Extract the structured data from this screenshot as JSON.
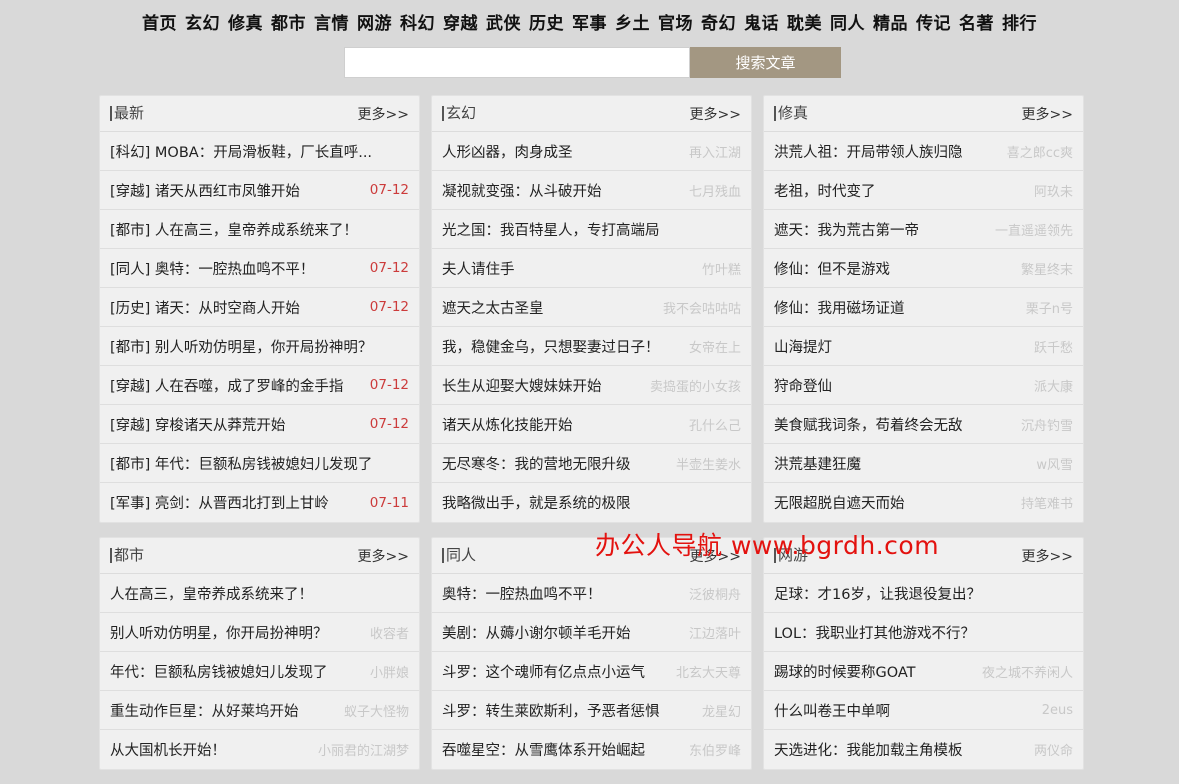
{
  "nav": [
    "首页",
    "玄幻",
    "修真",
    "都市",
    "言情",
    "网游",
    "科幻",
    "穿越",
    "武侠",
    "历史",
    "军事",
    "乡土",
    "官场",
    "奇幻",
    "鬼话",
    "耽美",
    "同人",
    "精品",
    "传记",
    "名著",
    "排行"
  ],
  "search": {
    "placeholder": "",
    "button_label": "搜索文章"
  },
  "panels": [
    {
      "title": "最新",
      "more": "更多>>",
      "rows": [
        {
          "title": "[科幻] MOBA：开局滑板鞋，厂长直呼...",
          "meta": ""
        },
        {
          "title": "[穿越] 诸天从西红市凤雏开始",
          "meta": "07-12"
        },
        {
          "title": "[都市] 人在高三，皇帝养成系统来了！",
          "meta": ""
        },
        {
          "title": "[同人] 奥特：一腔热血鸣不平！",
          "meta": "07-12"
        },
        {
          "title": "[历史] 诸天：从时空商人开始",
          "meta": "07-12"
        },
        {
          "title": "[都市] 别人听劝仿明星，你开局扮神明？",
          "meta": ""
        },
        {
          "title": "[穿越] 人在吞噬，成了罗峰的金手指",
          "meta": "07-12"
        },
        {
          "title": "[穿越] 穿梭诸天从莽荒开始",
          "meta": "07-12"
        },
        {
          "title": "[都市] 年代：巨额私房钱被媳妇儿发现了",
          "meta": ""
        },
        {
          "title": "[军事] 亮剑：从晋西北打到上甘岭",
          "meta": "07-11"
        }
      ]
    },
    {
      "title": "玄幻",
      "more": "更多>>",
      "rows": [
        {
          "title": "人形凶器，肉身成圣",
          "meta": "再入江湖"
        },
        {
          "title": "凝视就变强：从斗破开始",
          "meta": "七月残血"
        },
        {
          "title": "光之国：我百特星人，专打高端局",
          "meta": ""
        },
        {
          "title": "夫人请住手",
          "meta": "竹叶糕"
        },
        {
          "title": "遮天之太古圣皇",
          "meta": "我不会咕咕咕"
        },
        {
          "title": "我，稳健金乌，只想娶妻过日子！",
          "meta": "女帝在上"
        },
        {
          "title": "长生从迎娶大嫂妹妹开始",
          "meta": "卖捣蛋的小女孩"
        },
        {
          "title": "诸天从炼化技能开始",
          "meta": "孔什么己"
        },
        {
          "title": "无尽寒冬：我的营地无限升级",
          "meta": "半壶生姜水"
        },
        {
          "title": "我略微出手，就是系统的极限",
          "meta": ""
        }
      ]
    },
    {
      "title": "修真",
      "more": "更多>>",
      "rows": [
        {
          "title": "洪荒人祖：开局带领人族归隐",
          "meta": "喜之郎cc爽"
        },
        {
          "title": "老祖，时代变了",
          "meta": "阿玖未"
        },
        {
          "title": "遮天：我为荒古第一帝",
          "meta": "一直遥遥领先"
        },
        {
          "title": "修仙：但不是游戏",
          "meta": "繁星终末"
        },
        {
          "title": "修仙：我用磁场证道",
          "meta": "栗子n号"
        },
        {
          "title": "山海提灯",
          "meta": "跃千愁"
        },
        {
          "title": "狩命登仙",
          "meta": "派大康"
        },
        {
          "title": "美食赋我词条，苟着终会无敌",
          "meta": "沉舟钓雪"
        },
        {
          "title": "洪荒基建狂魔",
          "meta": "w风雪"
        },
        {
          "title": "无限超脱自遮天而始",
          "meta": "持笔难书"
        }
      ]
    },
    {
      "title": "都市",
      "more": "更多>>",
      "rows": [
        {
          "title": "人在高三，皇帝养成系统来了！",
          "meta": ""
        },
        {
          "title": "别人听劝仿明星，你开局扮神明？",
          "meta": "收容者"
        },
        {
          "title": "年代：巨额私房钱被媳妇儿发现了",
          "meta": "小胖娘"
        },
        {
          "title": "重生动作巨星：从好莱坞开始",
          "meta": "蚁子大怪物"
        },
        {
          "title": "从大国机长开始！",
          "meta": "小丽君的江湖梦"
        }
      ]
    },
    {
      "title": "同人",
      "more": "更多>>",
      "rows": [
        {
          "title": "奥特：一腔热血鸣不平！",
          "meta": "泛彼桐舟"
        },
        {
          "title": "美剧：从薅小谢尔顿羊毛开始",
          "meta": "江边落叶"
        },
        {
          "title": "斗罗：这个魂师有亿点点小运气",
          "meta": "北玄大天尊"
        },
        {
          "title": "斗罗：转生莱欧斯利，予恶者惩惧",
          "meta": "龙星幻"
        },
        {
          "title": "吞噬星空：从雪鹰体系开始崛起",
          "meta": "东伯罗峰"
        }
      ]
    },
    {
      "title": "网游",
      "more": "更多>>",
      "rows": [
        {
          "title": "足球：才16岁，让我退役复出？",
          "meta": ""
        },
        {
          "title": "LOL：我职业打其他游戏不行？",
          "meta": ""
        },
        {
          "title": "踢球的时候要称GOAT",
          "meta": "夜之城不养闲人"
        },
        {
          "title": "什么叫卷王中单啊",
          "meta": "2eus"
        },
        {
          "title": "天选进化：我能加载主角模板",
          "meta": "两仪命"
        }
      ]
    }
  ],
  "watermark": "办公人导航  www.bgrdh.com"
}
